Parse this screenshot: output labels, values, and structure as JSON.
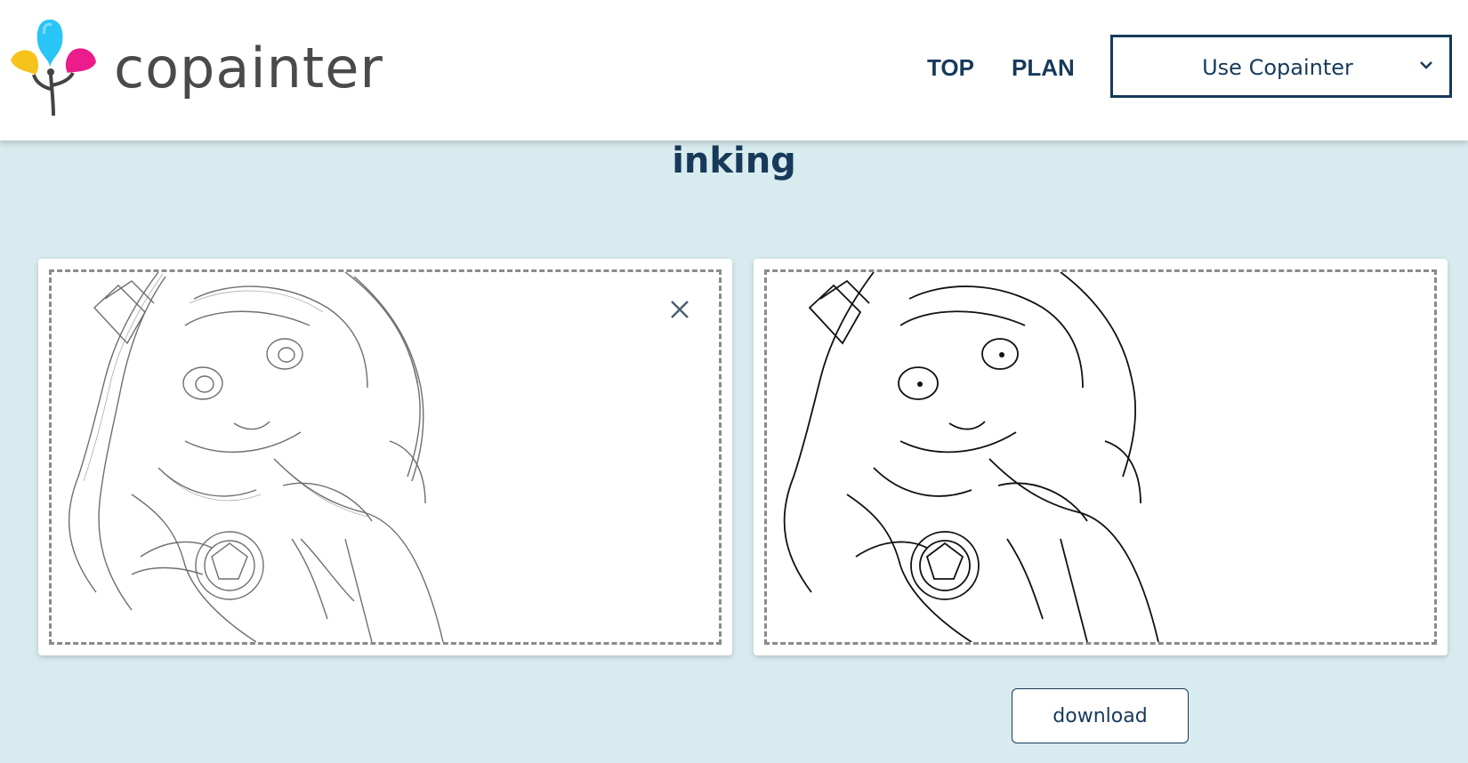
{
  "header": {
    "logo_text": "copainter",
    "nav": [
      {
        "label": "TOP"
      },
      {
        "label": "PLAN"
      }
    ],
    "use_select": {
      "selected": "Use Copainter"
    }
  },
  "main": {
    "title": "inking",
    "download_label": "download"
  },
  "colors": {
    "background": "#d8ebee",
    "header_bg": "#ffffff",
    "accent_navy": "#173a5a",
    "logo_cyan": "#29c5f6",
    "logo_magenta": "#ec1c8c",
    "logo_yellow": "#f6c21c"
  },
  "icons": {
    "logo_mark": "flower-logo-icon",
    "select_chevron": "chevron-down-icon",
    "close": "close-icon"
  }
}
